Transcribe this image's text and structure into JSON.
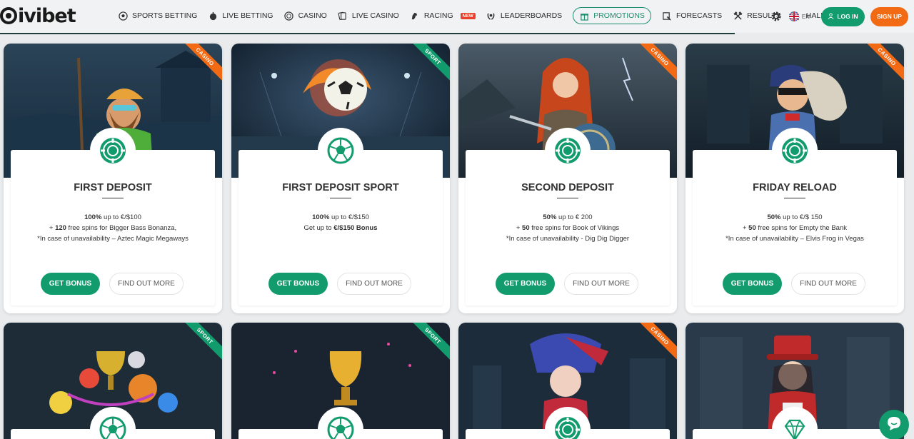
{
  "header": {
    "logo": "ivibet",
    "nav": [
      {
        "label": "SPORTS BETTING",
        "icon": "soccer-ball-icon"
      },
      {
        "label": "LIVE BETTING",
        "icon": "live-icon"
      },
      {
        "label": "CASINO",
        "icon": "casino-chip-icon"
      },
      {
        "label": "LIVE CASINO",
        "icon": "cards-icon"
      },
      {
        "label": "RACING",
        "icon": "horse-icon",
        "badge": "NEW"
      },
      {
        "label": "LEADERBOARDS",
        "icon": "laurel-icon"
      },
      {
        "label": "PROMOTIONS",
        "icon": "gift-icon",
        "active": true
      },
      {
        "label": "FORECASTS",
        "icon": "forecast-icon"
      },
      {
        "label": "RESULTS",
        "icon": "hammers-icon"
      },
      {
        "label": "HALL OF FAME",
        "icon": "podium-icon"
      }
    ],
    "lang": "EN",
    "login": "LOG IN",
    "signup": "SIGN UP"
  },
  "colors": {
    "brand_green": "#129c6d",
    "brand_orange": "#f36a14"
  },
  "promos": [
    {
      "tag": "CASINO",
      "title": "FIRST DEPOSIT",
      "line1_bold": "100%",
      "line1_rest": " up to €/$100",
      "line2_prefix": "+ ",
      "line2_bold": "120",
      "line2_rest": " free spins for Bigger Bass Bonanza,",
      "line3": "*In case of unavailability – Aztec Magic Megaways",
      "icon": "casino-chip-icon",
      "primary": "GET BONUS",
      "secondary": "FIND OUT MORE"
    },
    {
      "tag": "SPORT",
      "title": "FIRST DEPOSIT SPORT",
      "line1_bold": "100%",
      "line1_rest": " up to €/$150",
      "line2_prefix": "Get up to ",
      "line2_bold": "€/$150 Bonus",
      "line2_rest": "",
      "line3": "",
      "icon": "soccer-ball-icon",
      "primary": "GET BONUS",
      "secondary": "FIND OUT MORE"
    },
    {
      "tag": "CASINO",
      "title": "SECOND DEPOSIT",
      "line1_bold": "50%",
      "line1_rest": " up to € 200",
      "line2_prefix": "+ ",
      "line2_bold": "50",
      "line2_rest": " free spins for Book of Vikings",
      "line3": "*In case of unavailability - Dig Dig Digger",
      "icon": "casino-chip-icon",
      "primary": "GET BONUS",
      "secondary": "FIND OUT MORE"
    },
    {
      "tag": "CASINO",
      "title": "FRIDAY RELOAD",
      "line1_bold": "50%",
      "line1_rest": " up to €/$ 150",
      "line2_prefix": "+ ",
      "line2_bold": "50",
      "line2_rest": " free spins for Empty the Bank",
      "line3": "*In case of unavailability – Elvis Frog in Vegas",
      "icon": "casino-chip-icon",
      "primary": "GET BONUS",
      "secondary": "FIND OUT MORE"
    },
    {
      "tag": "SPORT",
      "icon": "soccer-ball-icon"
    },
    {
      "tag": "SPORT",
      "icon": "soccer-ball-icon"
    },
    {
      "tag": "CASINO",
      "icon": "casino-chip-icon"
    },
    {
      "tag": "",
      "icon": "diamond-icon"
    }
  ]
}
